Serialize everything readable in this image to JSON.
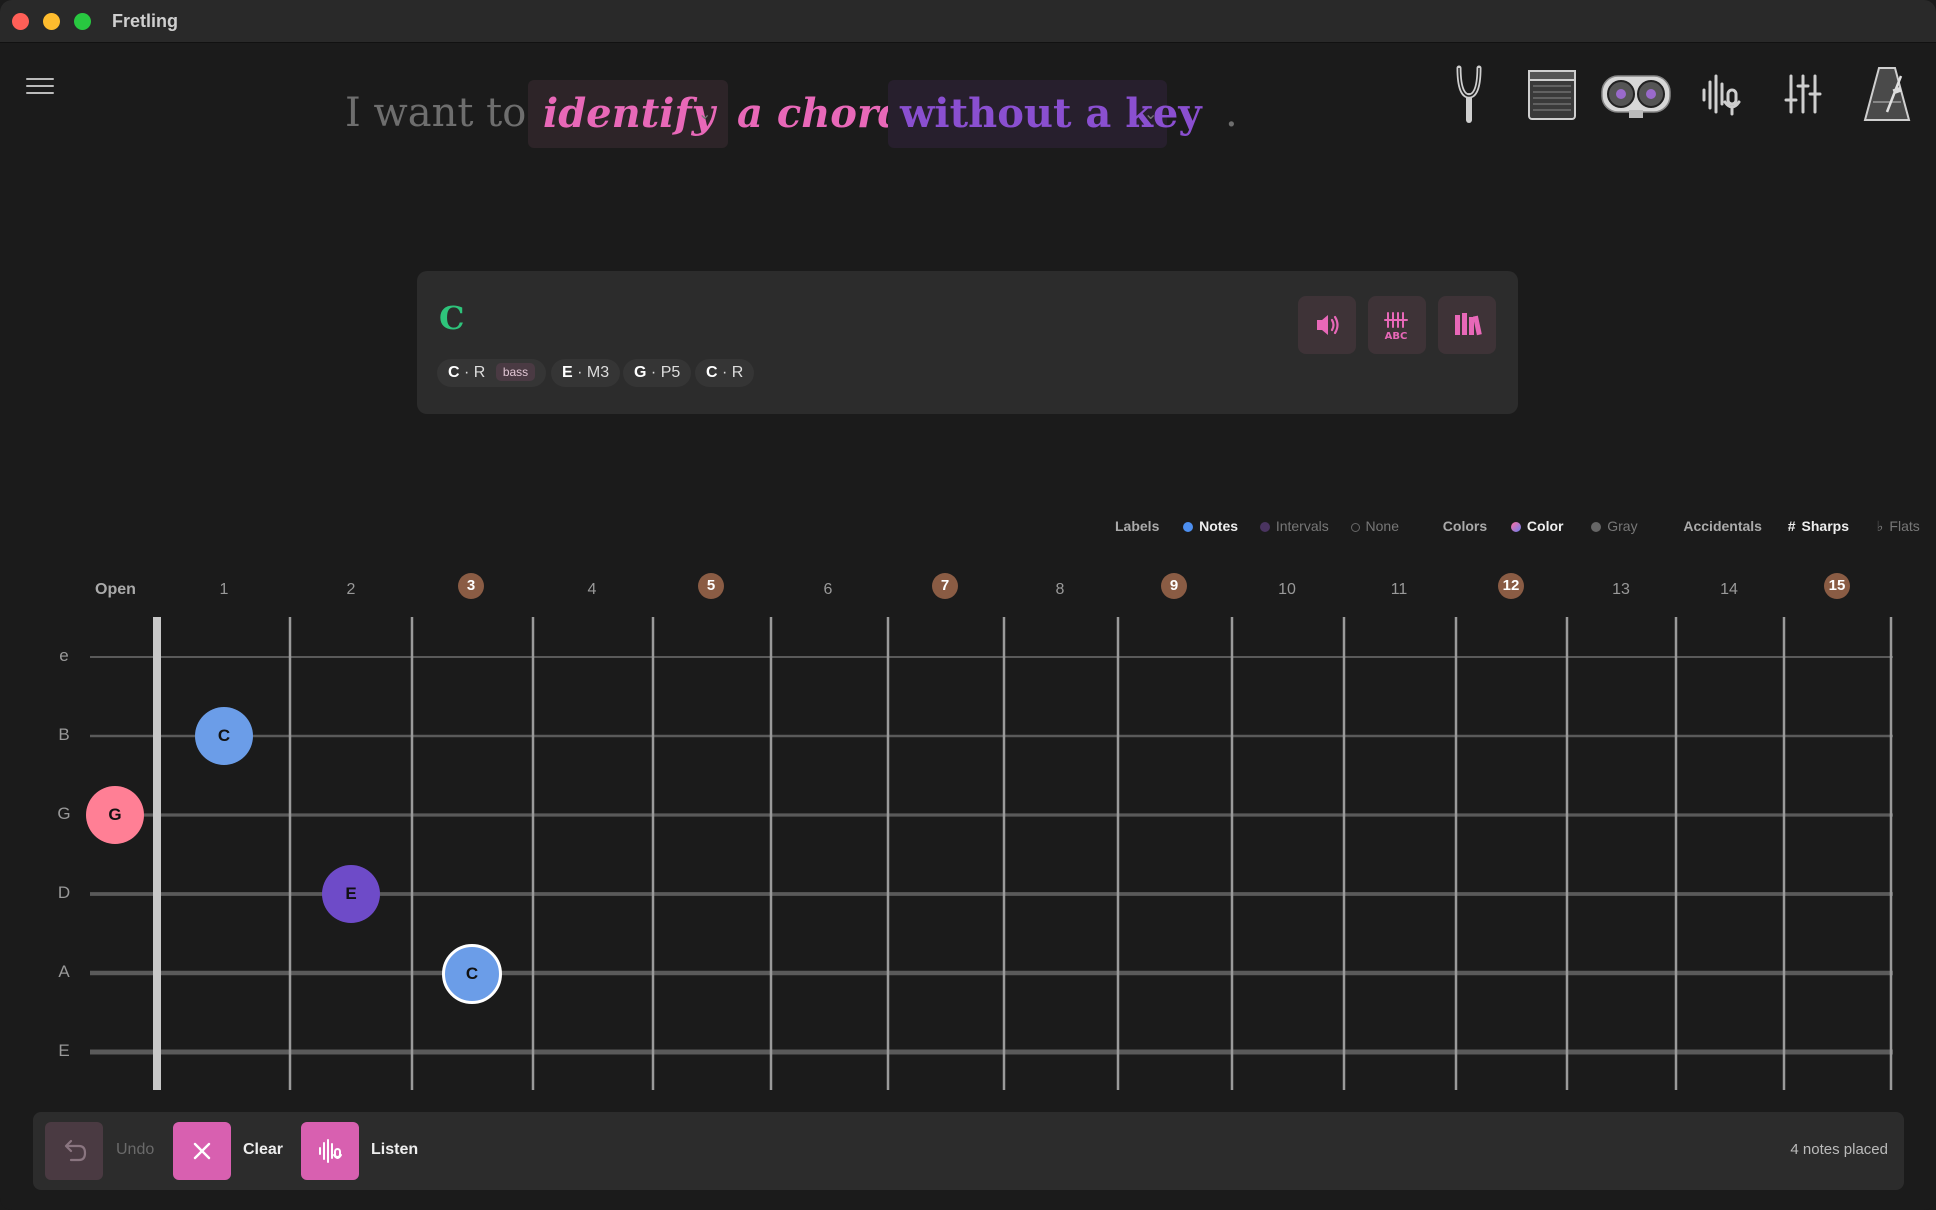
{
  "window": {
    "title": "Fretling"
  },
  "sentence": {
    "prefix": "I want to",
    "verb": "identify",
    "object": "a chord",
    "context": "without a key",
    "period": ".",
    "colors": {
      "verb": "#e868b8",
      "context": "#8a4fd0",
      "muted": "#6e6e6e"
    }
  },
  "tools": [
    "tuning-fork-icon",
    "amplifier-icon",
    "tape-reels-icon",
    "voice-input-icon",
    "mixer-sliders-icon",
    "metronome-icon"
  ],
  "chord": {
    "name": "C",
    "notes": [
      {
        "note": "C",
        "interval": "R",
        "badge": "bass"
      },
      {
        "note": "E",
        "interval": "M3"
      },
      {
        "note": "G",
        "interval": "P5"
      },
      {
        "note": "C",
        "interval": "R"
      }
    ],
    "separator": "·",
    "actions": [
      "play-icon",
      "tab-icon",
      "library-icon"
    ]
  },
  "legend": {
    "labels": {
      "title": "Labels",
      "options": [
        "Notes",
        "Intervals",
        "None"
      ],
      "selected": "Notes"
    },
    "colors": {
      "title": "Colors",
      "options": [
        "Color",
        "Gray"
      ],
      "selected": "Color"
    },
    "accidentals": {
      "title": "Accidentals",
      "options": [
        "Sharps",
        "Flats"
      ],
      "selected": "Sharps",
      "symbols": [
        "#",
        "♭"
      ]
    }
  },
  "fretboard": {
    "open_label": "Open",
    "frets": [
      "1",
      "2",
      "3",
      "4",
      "5",
      "6",
      "7",
      "8",
      "9",
      "10",
      "11",
      "12",
      "13",
      "14",
      "15"
    ],
    "marked_frets": [
      "3",
      "5",
      "7",
      "9",
      "12",
      "15"
    ],
    "strings": [
      "e",
      "B",
      "G",
      "D",
      "A",
      "E"
    ],
    "placed": [
      {
        "string": "B",
        "fret": 1,
        "note": "C",
        "color": "#6b9de8"
      },
      {
        "string": "G",
        "fret": 0,
        "note": "G",
        "color": "#ff7f95"
      },
      {
        "string": "D",
        "fret": 2,
        "note": "E",
        "color": "#6e4bc8"
      },
      {
        "string": "A",
        "fret": 3,
        "note": "C",
        "color": "#6b9de8",
        "bass": true
      }
    ]
  },
  "bottom": {
    "undo": "Undo",
    "clear": "Clear",
    "listen": "Listen",
    "status": "4 notes placed"
  }
}
